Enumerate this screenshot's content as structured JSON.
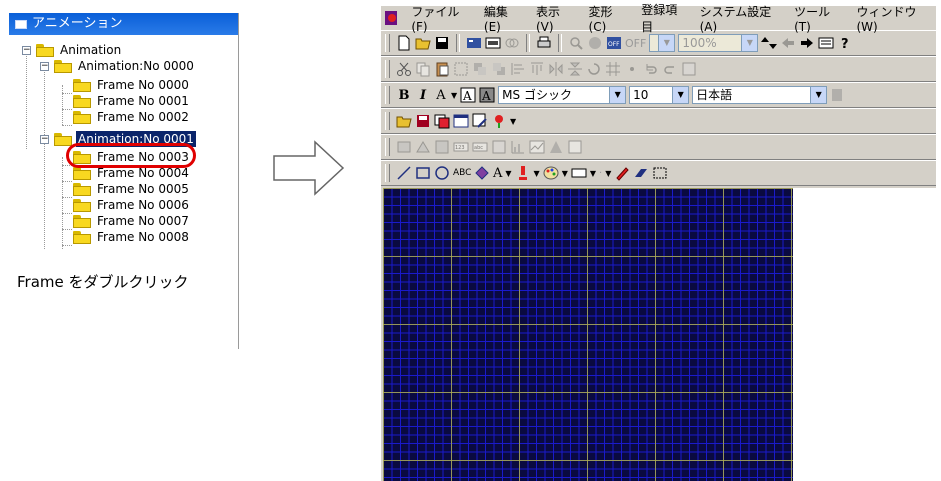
{
  "tree": {
    "title": "アニメーション",
    "root": "Animation",
    "nodes": [
      {
        "label": "Animation:No 0000"
      },
      {
        "label": "Frame No 0000"
      },
      {
        "label": "Frame No 0001"
      },
      {
        "label": "Frame No 0002"
      },
      {
        "label": "Animation:No 0001"
      },
      {
        "label": "Frame No 0003"
      },
      {
        "label": "Frame No 0004"
      },
      {
        "label": "Frame No 0005"
      },
      {
        "label": "Frame No 0006"
      },
      {
        "label": "Frame No 0007"
      },
      {
        "label": "Frame No 0008"
      }
    ],
    "instruction": "Frame をダブルクリック"
  },
  "menubar": {
    "items": [
      "ファイル(F)",
      "編集(E)",
      "表示(V)",
      "変形(C)",
      "登録項目",
      "システム設定(A)",
      "ツール(T)",
      "ウィンドウ(W)"
    ]
  },
  "toolbar1": {
    "toggle_label": "OFF",
    "zoom_value": "100%"
  },
  "font_toolbar": {
    "font_name": "MS ゴシック",
    "font_size": "10",
    "language": "日本語",
    "bold": "B",
    "italic": "I",
    "font_color": "A"
  },
  "text_tool": "ABC",
  "colors": {
    "accent": "#0a5fd8",
    "selection": "#0a246a",
    "highlight_ring": "#e00000",
    "canvas": "#0a0a40",
    "grid_minor": "#1a1acc",
    "grid_major": "#b4b43c"
  }
}
